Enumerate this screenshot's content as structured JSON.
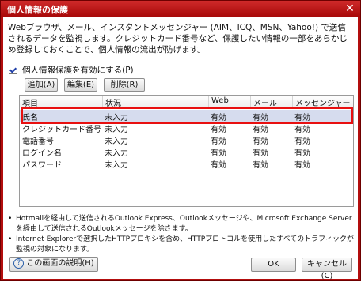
{
  "window": {
    "title": "個人情報の保護",
    "close_glyph": "✕"
  },
  "description": "Webブラウザ、メール、インスタントメッセンジャー (AIM、ICQ、MSN、Yahoo!) で送信されるデータを監視します。クレジットカード番号など、保護したい情報の一部をあらかじめ登録しておくことで、個人情報の流出が防げます。",
  "protection_checkbox": {
    "label": "個人情報保護を有効にする(P)",
    "checked": true
  },
  "buttons": {
    "add": "追加(A)",
    "edit": "編集(E)",
    "delete": "削除(R)"
  },
  "table": {
    "columns": [
      "項目",
      "状況",
      "Web",
      "メール",
      "メッセンジャー"
    ],
    "rows": [
      [
        "氏名",
        "未入力",
        "有効",
        "有効",
        "有効"
      ],
      [
        "クレジットカード番号",
        "未入力",
        "有効",
        "有効",
        "有効"
      ],
      [
        "電話番号",
        "未入力",
        "有効",
        "有効",
        "有効"
      ],
      [
        "ログイン名",
        "未入力",
        "有効",
        "有効",
        "有効"
      ],
      [
        "パスワード",
        "未入力",
        "有効",
        "有効",
        "有効"
      ]
    ],
    "selected_index": 0
  },
  "notes": [
    "Hotmailを経由して送信されるOutlook Express、Outlookメッセージや、Microsoft Exchange Serverを経由して送信されるOutlookメッセージを除きます。",
    "Internet Explorerで選択したHTTPプロキシを含め、HTTPプロトコルを使用したすべてのトラフィックが監視の対象になります。"
  ],
  "footer": {
    "help_label": "この画面の説明(H)",
    "help_icon": "?",
    "ok_label": "OK",
    "cancel_label": "キャンセル(C)"
  },
  "colors": {
    "title_bar": "#b30e0e",
    "selection_outline": "#e81010",
    "selected_row": "#d6dcee"
  }
}
